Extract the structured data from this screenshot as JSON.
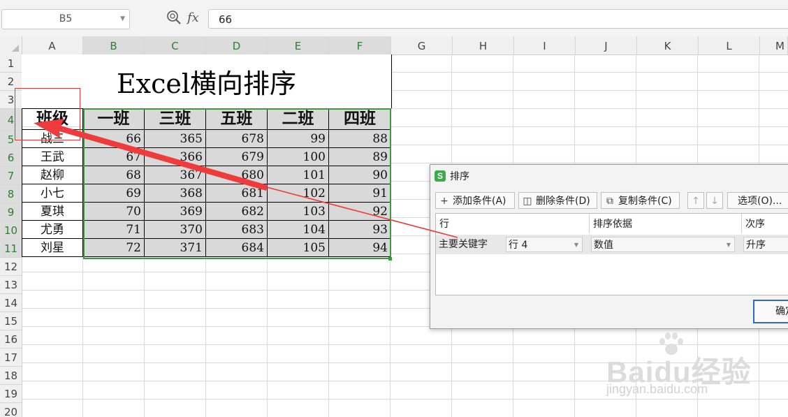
{
  "formula_bar": {
    "cell_ref": "B5",
    "fx_label": "fx",
    "formula_value": "66"
  },
  "columns": [
    "A",
    "B",
    "C",
    "D",
    "E",
    "F",
    "G",
    "H",
    "I",
    "J",
    "K",
    "L",
    "M"
  ],
  "rows": [
    "1",
    "2",
    "3",
    "4",
    "5",
    "6",
    "7",
    "8",
    "9",
    "10",
    "11",
    "12",
    "13",
    "14",
    "15",
    "16",
    "17",
    "18",
    "19",
    "20"
  ],
  "sheet": {
    "title": "Excel横向排序",
    "header_row": [
      "班级",
      "一班",
      "三班",
      "五班",
      "二班",
      "四班"
    ],
    "data_rows": [
      [
        "战三",
        "66",
        "365",
        "678",
        "99",
        "88"
      ],
      [
        "王武",
        "67",
        "366",
        "679",
        "100",
        "89"
      ],
      [
        "赵柳",
        "68",
        "367",
        "680",
        "101",
        "90"
      ],
      [
        "小七",
        "69",
        "368",
        "681",
        "102",
        "91"
      ],
      [
        "夏琪",
        "70",
        "369",
        "682",
        "103",
        "92"
      ],
      [
        "尤勇",
        "71",
        "370",
        "683",
        "104",
        "93"
      ],
      [
        "刘星",
        "72",
        "371",
        "684",
        "105",
        "94"
      ]
    ]
  },
  "dialog": {
    "logo_letter": "S",
    "title": "排序",
    "add_condition": "添加条件(A)",
    "delete_condition": "删除条件(D)",
    "copy_condition": "复制条件(C)",
    "options": "选项(O)...",
    "col_row": "行",
    "col_sort_by": "排序依据",
    "col_order": "次序",
    "primary_key_label": "主要关键字",
    "key_value": "行 4",
    "sort_by_value": "数值",
    "order_value": "升序",
    "ok_button": "确定"
  },
  "watermark": {
    "logo": "Baidu经验",
    "url": "jingyan.baidu.com"
  },
  "colors": {
    "selection_green": "#3c9a3c",
    "annotation_red": "#e53935",
    "cell_shade": "#d9d9d9",
    "ok_border": "#2b6cc4"
  }
}
